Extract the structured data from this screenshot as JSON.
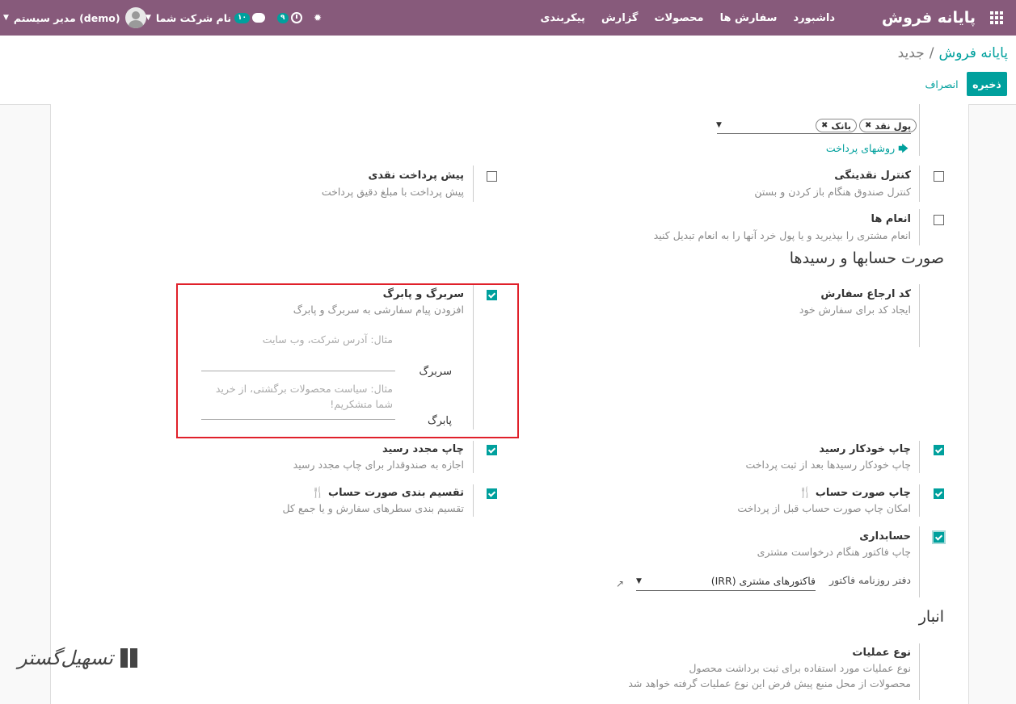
{
  "navbar": {
    "brand": "پایانه فروش",
    "menu": [
      "داشبورد",
      "سفارش ها",
      "محصولات",
      "گزارش",
      "پیکربندی"
    ],
    "user": "مدیر سیستم (demo)",
    "company": "نام شرکت شما",
    "chat_count": "۱۰",
    "activity_count": "۹"
  },
  "breadcrumb": {
    "parent": "پایانه فروش",
    "current": "جدید"
  },
  "buttons": {
    "save": "ذخیره",
    "discard": "انصراف"
  },
  "payment": {
    "tags": [
      "پول نقد",
      "بانک"
    ],
    "link": "روشهای پرداخت"
  },
  "settings": {
    "cash_control": {
      "title": "کنترل نقدینگی",
      "desc": "کنترل صندوق هنگام باز کردن و بستن",
      "checked": false
    },
    "cash_prepay": {
      "title": "پیش پرداخت نقدی",
      "desc": "پیش پرداخت با مبلغ دقیق پرداخت",
      "checked": false
    },
    "tips": {
      "title": "انعام ها",
      "desc": "انعام مشتری را بپذیرید و یا پول خرد آنها را به انعام تبدیل کنید",
      "checked": false
    },
    "order_ref": {
      "title": "کد ارجاع سفارش",
      "desc": "ایجاد کد برای سفارش خود"
    },
    "header_footer": {
      "title": "سربرگ و پابرگ",
      "desc": "افزودن پیام سفارشی به سربرگ و پابرگ",
      "checked": true,
      "header_placeholder": "مثال: آدرس شرکت، وب سایت",
      "header_label": "سربرگ",
      "footer_placeholder_1": "مثال: سیاست محصولات برگشتی، از خرید",
      "footer_placeholder_2": "شما متشکریم!",
      "footer_label": "پابرگ"
    },
    "auto_print": {
      "title": "چاپ خودکار رسید",
      "desc": "چاپ خودکار رسیدها بعد از ثبت پرداخت",
      "checked": true
    },
    "reprint": {
      "title": "چاپ مجدد رسید",
      "desc": "اجازه به صندوقدار برای چاپ مجدد رسید",
      "checked": true
    },
    "bill_print": {
      "title": "چاپ صورت حساب",
      "desc": "امکان چاپ صورت حساب قبل از پرداخت",
      "checked": true
    },
    "bill_split": {
      "title": "تقسیم بندی صورت حساب",
      "desc": "تقسیم بندی سطرهای سفارش و یا جمع کل",
      "checked": true
    },
    "invoicing": {
      "title": "حسابداری",
      "desc": "چاپ فاکتور هنگام درخواست مشتری",
      "checked": true,
      "journal_label": "دفتر روزنامه فاکتور",
      "journal_value": "فاکتورهای مشتری (IRR)"
    },
    "operation_type": {
      "title": "نوع عملیات",
      "desc_1": "نوع عملیات مورد استفاده برای ثبت برداشت محصول",
      "desc_2": "محصولات از محل منبع پیش فرض این نوع عملیات گرفته خواهد شد"
    }
  },
  "sections": {
    "bills": "صورت حسابها و رسیدها",
    "inventory": "انبار"
  },
  "watermark": "تسهیل‌گستر"
}
